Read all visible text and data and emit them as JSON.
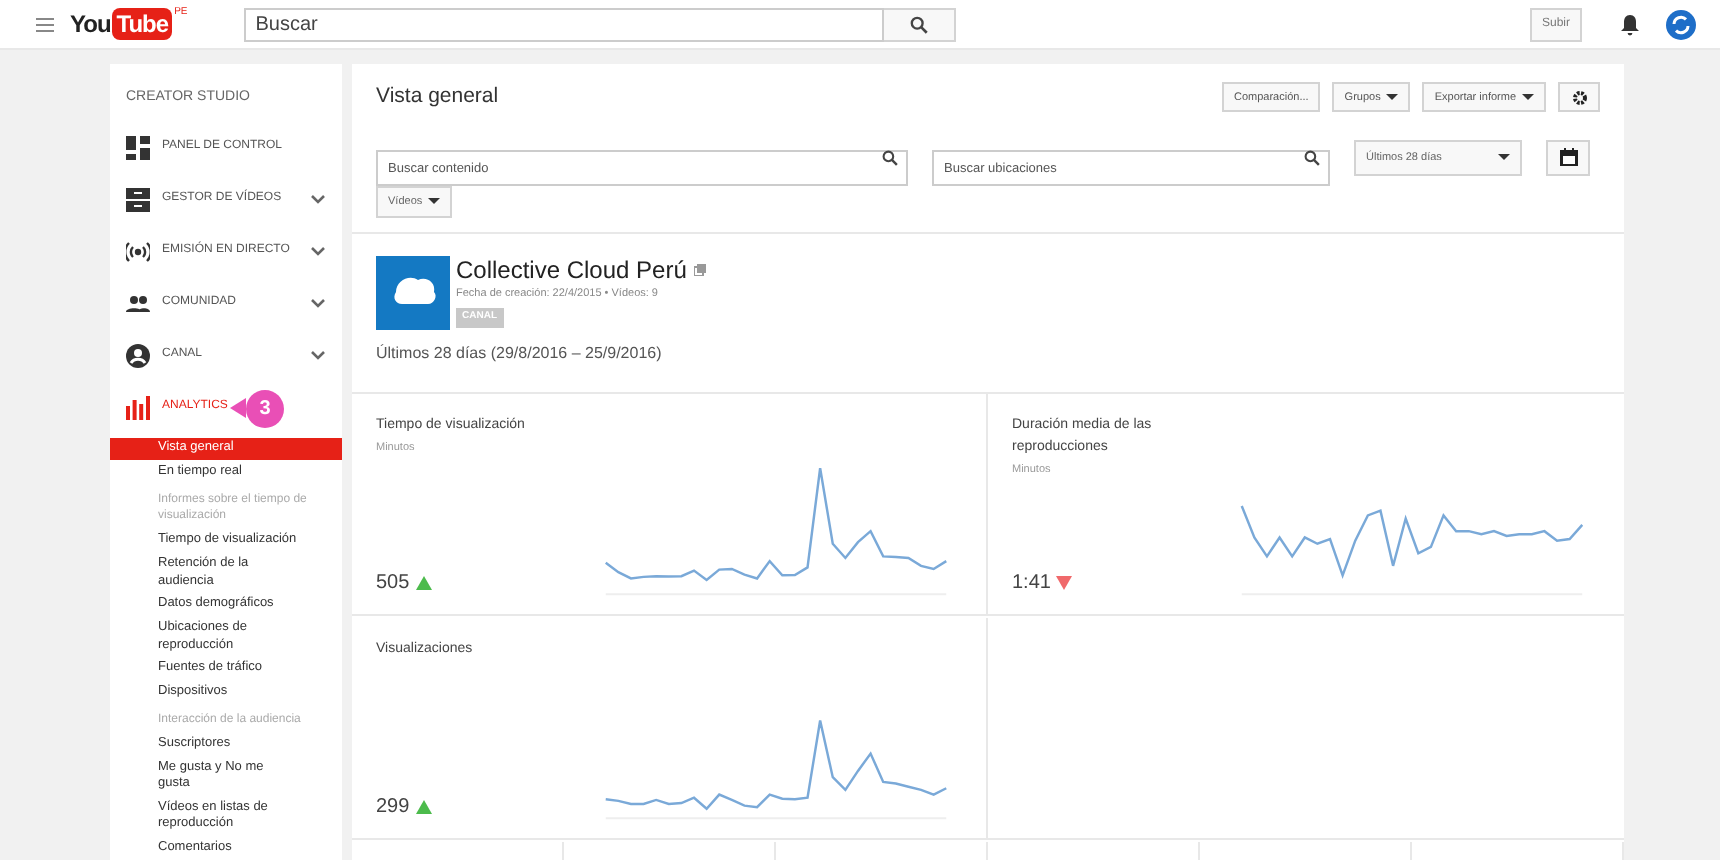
{
  "topbar": {
    "logo_first": "You",
    "logo_second": "Tube",
    "logo_suffix": "PE",
    "search_placeholder": "Buscar",
    "upload": "Subir"
  },
  "sidebar": {
    "title": "CREATOR STUDIO",
    "items": [
      {
        "kind": "dashboard",
        "label": "PANEL DE CONTROL",
        "expandable": false,
        "selected": false
      },
      {
        "kind": "videos",
        "label": "GESTOR DE VÍDEOS",
        "expandable": true,
        "selected": false
      },
      {
        "kind": "live",
        "label": "EMISIÓN EN DIRECTO",
        "expandable": true,
        "selected": false
      },
      {
        "kind": "community",
        "label": "COMUNIDAD",
        "expandable": true,
        "selected": false
      },
      {
        "kind": "channel",
        "label": "CANAL",
        "expandable": true,
        "selected": false
      },
      {
        "kind": "analytics",
        "label": "ANALYTICS",
        "expandable": false,
        "selected": true,
        "badge": "3"
      }
    ],
    "subitems": [
      {
        "kind": "link",
        "label": "Vista general",
        "selected": true
      },
      {
        "kind": "link",
        "label": "En tiempo real",
        "selected": false
      },
      {
        "kind": "heading",
        "label": "Informes sobre el tiempo de visualización"
      },
      {
        "kind": "link",
        "label": "Tiempo de visualización",
        "selected": false
      },
      {
        "kind": "link",
        "label": "Retención de la audiencia",
        "selected": false
      },
      {
        "kind": "link",
        "label": "Datos demográficos",
        "selected": false
      },
      {
        "kind": "link",
        "label": "Ubicaciones de reproducción",
        "selected": false
      },
      {
        "kind": "link",
        "label": "Fuentes de tráfico",
        "selected": false
      },
      {
        "kind": "link",
        "label": "Dispositivos",
        "selected": false
      },
      {
        "kind": "heading",
        "label": "Interacción de la audiencia"
      },
      {
        "kind": "link",
        "label": "Suscriptores",
        "selected": false
      },
      {
        "kind": "link",
        "label": "Me gusta y No me gusta",
        "selected": false
      },
      {
        "kind": "link",
        "label": "Vídeos en listas de reproducción",
        "selected": false
      },
      {
        "kind": "link",
        "label": "Comentarios",
        "selected": false
      }
    ]
  },
  "main": {
    "title": "Vista general",
    "buttons": [
      {
        "label": "Comparación...",
        "dropdown": false
      },
      {
        "label": "Grupos",
        "dropdown": true
      },
      {
        "label": "Exportar informe",
        "dropdown": true
      }
    ],
    "content_search_placeholder": "Buscar contenido",
    "location_search_placeholder": "Buscar ubicaciones",
    "period": "Últimos 28 días",
    "type_filter": "Vídeos",
    "channel": {
      "name": "Collective Cloud Perú",
      "meta": "Fecha de creación: 22/4/2015 • Vídeos: 9",
      "badge": "CANAL"
    },
    "range": "Últimos 28 días (29/8/2016 – 25/9/2016)",
    "cards": [
      {
        "title": "Tiempo de visualización",
        "unit": "Minutos",
        "value": "505",
        "rising": true
      },
      {
        "title": "Duración media de las reproducciones",
        "unit": "Minutos",
        "value": "1:41",
        "rising": false
      },
      {
        "title": "Visualizaciones",
        "value": "299",
        "rising": true
      }
    ]
  }
}
